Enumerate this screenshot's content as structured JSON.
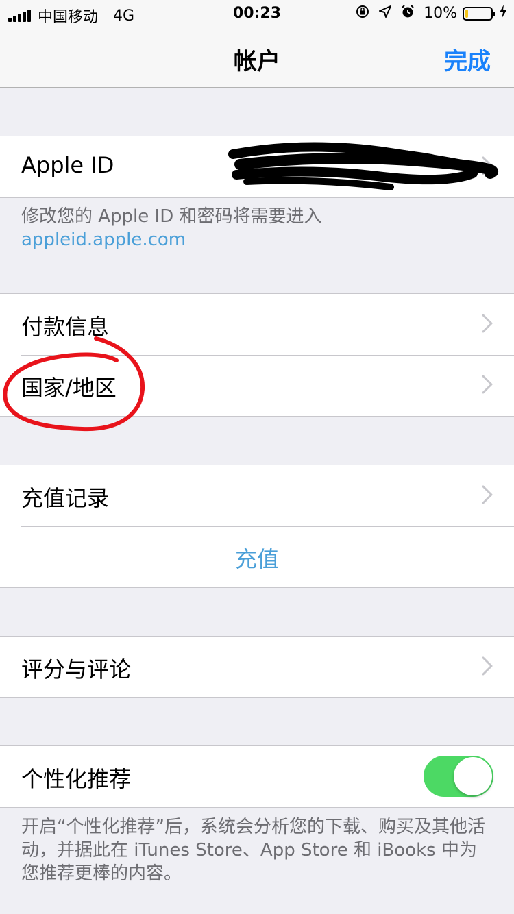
{
  "status_bar": {
    "carrier": "中国移动",
    "network": "4G",
    "time": "00:23",
    "battery_percent": "10%",
    "battery_level": 0.1
  },
  "nav": {
    "title": "帐户",
    "done_label": "完成"
  },
  "apple_id": {
    "label": "Apple ID",
    "footer_text": "修改您的 Apple ID 和密码将需要进入",
    "footer_link": "appleid.apple.com"
  },
  "account_items": [
    {
      "label": "付款信息"
    },
    {
      "label": "国家/地区"
    }
  ],
  "purchase": {
    "history_label": "充值记录",
    "topup_label": "充值"
  },
  "ratings": {
    "label": "评分与评论"
  },
  "personalization": {
    "label": "个性化推荐",
    "enabled": true,
    "footer": "开启“个性化推荐”后，系统会分析您的下载、购买及其他活动，并据此在 iTunes Store、App Store 和 iBooks 中为您推荐更棒的内容。"
  },
  "colors": {
    "accent": "#1a82fb",
    "link": "#4a9fd8",
    "toggle_on": "#4cd964",
    "annotation": "#e8131b"
  }
}
